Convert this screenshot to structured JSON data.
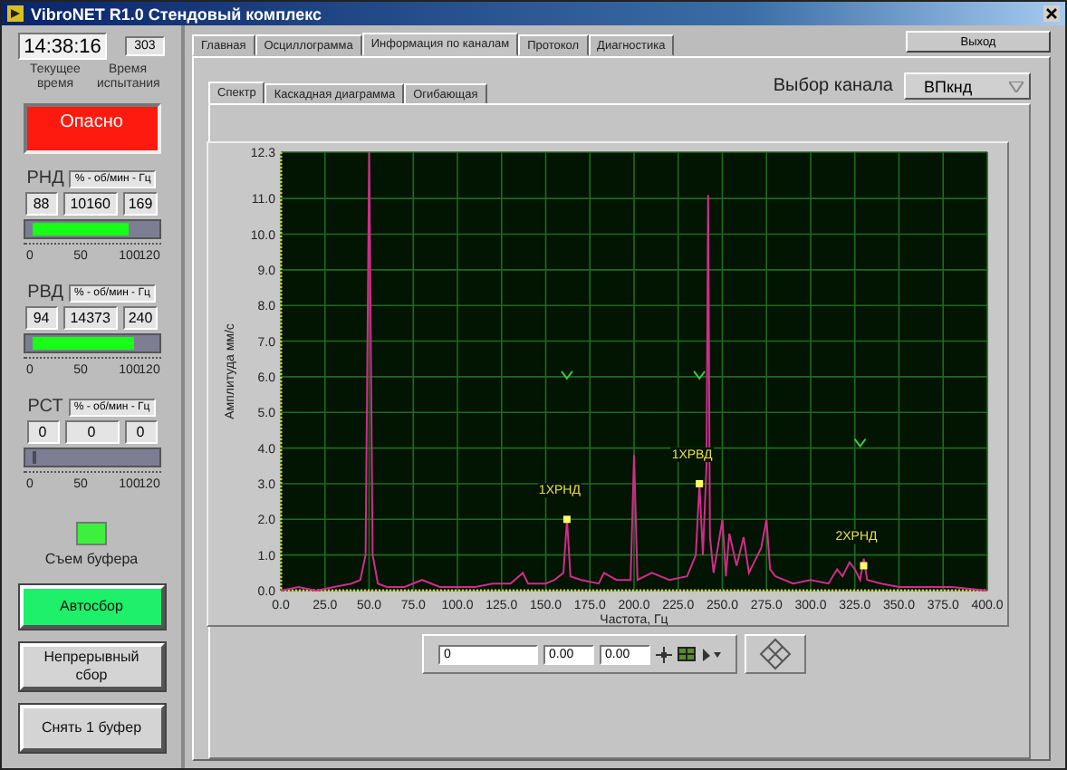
{
  "window": {
    "title": "VibroNET R1.0 Стендовый комплекс"
  },
  "clock": {
    "current_time": "14:38:16",
    "test_time": "303",
    "current_label": "Текущее время",
    "test_label": "Время испытания"
  },
  "alarm": {
    "text": "Опасно",
    "active": true
  },
  "gauges": [
    {
      "name": "РНД",
      "units": "% - об/мин - Гц",
      "values": [
        "88",
        "10160",
        "169"
      ],
      "level": 0.73,
      "scale": [
        "0",
        "50",
        "100",
        "120"
      ]
    },
    {
      "name": "РВД",
      "units": "% - об/мин - Гц",
      "values": [
        "94",
        "14373",
        "240"
      ],
      "level": 0.78,
      "scale": [
        "0",
        "50",
        "100",
        "120"
      ]
    },
    {
      "name": "РСТ",
      "units": "% - об/мин - Гц",
      "values": [
        "0",
        "0",
        "0"
      ],
      "level": 0,
      "scale": [
        "0",
        "50",
        "100",
        "120"
      ]
    }
  ],
  "buffer_led": {
    "label": "Съем буфера",
    "on": true
  },
  "buttons": [
    {
      "label": "Автосбор",
      "on": true
    },
    {
      "label": "Непрерывный сбор",
      "on": false
    },
    {
      "label": "Снять 1 буфер",
      "on": false
    }
  ],
  "tabs": [
    {
      "label": "Главная",
      "selected": false
    },
    {
      "label": "Осциллограмма",
      "selected": false
    },
    {
      "label": "Информация по каналам",
      "selected": true
    },
    {
      "label": "Протокол",
      "selected": false
    },
    {
      "label": "Диагностика",
      "selected": false
    }
  ],
  "exit_button": "Выход",
  "subtabs": [
    {
      "label": "Спектр",
      "selected": true
    },
    {
      "label": "Каскадная диаграмма",
      "selected": false
    },
    {
      "label": "Огибающая",
      "selected": false
    }
  ],
  "channel_select": {
    "label": "Выбор канала",
    "value": "ВПкнд"
  },
  "chart_data": {
    "type": "line",
    "xlabel": "Частота, Гц",
    "ylabel": "Амплитуда мм/с",
    "xlim": [
      0,
      400
    ],
    "ylim": [
      0,
      12.3
    ],
    "xticks": [
      {
        "value": 0,
        "label": "0.0"
      },
      {
        "value": 25,
        "label": "25.0"
      },
      {
        "value": 50,
        "label": "50.0"
      },
      {
        "value": 75,
        "label": "75.0"
      },
      {
        "value": 100,
        "label": "100.0"
      },
      {
        "value": 125,
        "label": "125.0"
      },
      {
        "value": 150,
        "label": "150.0"
      },
      {
        "value": 175,
        "label": "175.0"
      },
      {
        "value": 200,
        "label": "200.0"
      },
      {
        "value": 225,
        "label": "225.0"
      },
      {
        "value": 250,
        "label": "250.0"
      },
      {
        "value": 275,
        "label": "275.0"
      },
      {
        "value": 300,
        "label": "300.0"
      },
      {
        "value": 325,
        "label": "325.0"
      },
      {
        "value": 350,
        "label": "350.0"
      },
      {
        "value": 375,
        "label": "375.0"
      },
      {
        "value": 400,
        "label": "400.0"
      }
    ],
    "yticks": [
      {
        "value": 0,
        "label": "0.0"
      },
      {
        "value": 1,
        "label": "1.0"
      },
      {
        "value": 2,
        "label": "2.0"
      },
      {
        "value": 3,
        "label": "3.0"
      },
      {
        "value": 4,
        "label": "4.0"
      },
      {
        "value": 5,
        "label": "5.0"
      },
      {
        "value": 6,
        "label": "6.0"
      },
      {
        "value": 7,
        "label": "7.0"
      },
      {
        "value": 8,
        "label": "8.0"
      },
      {
        "value": 9,
        "label": "9.0"
      },
      {
        "value": 10,
        "label": "10.0"
      },
      {
        "value": 11,
        "label": "11.0"
      },
      {
        "value": 12.3,
        "label": "12.3"
      }
    ],
    "x": [
      0,
      10,
      20,
      30,
      40,
      45,
      48,
      50,
      52,
      55,
      60,
      70,
      80,
      90,
      100,
      110,
      120,
      130,
      137,
      140,
      150,
      155,
      160,
      162,
      164,
      170,
      180,
      183,
      190,
      198,
      200,
      202,
      210,
      220,
      230,
      235,
      237,
      239,
      241,
      242,
      243,
      245,
      250,
      252,
      254,
      258,
      262,
      265,
      268,
      272,
      275,
      277,
      280,
      290,
      300,
      310,
      315,
      318,
      322,
      325,
      328,
      330,
      332,
      340,
      350,
      360,
      380,
      400
    ],
    "grid": true,
    "series": [
      {
        "color": "#d02c8c",
        "values": [
          0,
          0.1,
          0,
          0.1,
          0.2,
          0.3,
          1.0,
          12.3,
          1.0,
          0.2,
          0.1,
          0.1,
          0.3,
          0.1,
          0.1,
          0.1,
          0.2,
          0.2,
          0.5,
          0.2,
          0.2,
          0.3,
          0.5,
          2.0,
          0.4,
          0.3,
          0.2,
          0.5,
          0.3,
          0.3,
          3.8,
          0.3,
          0.5,
          0.3,
          0.4,
          1.0,
          3.0,
          1.0,
          3.5,
          11.1,
          1.5,
          0.5,
          2.0,
          0.4,
          1.6,
          0.7,
          1.5,
          0.5,
          0.8,
          1.2,
          2.0,
          0.6,
          0.4,
          0.2,
          0.3,
          0.2,
          0.6,
          0.4,
          0.8,
          0.6,
          0.3,
          0.9,
          0.3,
          0.2,
          0.1,
          0.1,
          0.1,
          0
        ]
      }
    ],
    "annotations": [
      {
        "x": 162,
        "y": 2.0,
        "text": "1XРНД"
      },
      {
        "x": 237,
        "y": 3.0,
        "text": "1XРВД"
      },
      {
        "x": 330,
        "y": 0.7,
        "text": "2XРНД"
      }
    ]
  },
  "cursor_fields": [
    "0",
    "0.00",
    "0.00"
  ]
}
